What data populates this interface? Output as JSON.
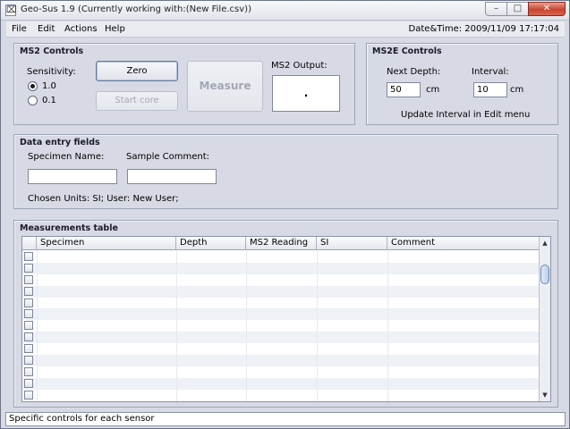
{
  "window": {
    "title": "Geo-Sus 1.9 (Currently working with:(New File.csv))",
    "minimize": "–",
    "maximize": "□",
    "close": "✕"
  },
  "menu": {
    "items": [
      "File",
      "Edit",
      "Actions",
      "Help"
    ],
    "datetime": "Date&Time: 2009/11/09 17:17:04"
  },
  "ms2": {
    "title": "MS2 Controls",
    "sensitivity_label": "Sensitivity:",
    "option_1": "1.0",
    "option_2": "0.1",
    "selected": "1.0",
    "zero_button": "Zero",
    "start_core_button": "Start core",
    "measure_button": "Measure",
    "output_label": "MS2 Output:",
    "output_value": "."
  },
  "ms2e": {
    "title": "MS2E Controls",
    "next_depth_label": "Next Depth:",
    "next_depth_value": "50",
    "next_depth_unit": "cm",
    "interval_label": "Interval:",
    "interval_value": "10",
    "interval_unit": "cm",
    "update_note": "Update Interval in Edit menu"
  },
  "data_entry": {
    "title": "Data entry fields",
    "specimen_label": "Specimen Name:",
    "specimen_value": "",
    "comment_label": "Sample Comment:",
    "comment_value": "",
    "units_info": "Chosen Units: SI;  User: New User;"
  },
  "table": {
    "title": "Measurements table",
    "columns": [
      "Specimen",
      "Depth",
      "MS2 Reading",
      "SI",
      "Comment"
    ],
    "row_count": 13
  },
  "statusbar": {
    "text": "Specific controls for each sensor"
  },
  "icons": {
    "app": "app-icon",
    "scroll_up": "arrow-up-icon",
    "scroll_down": "arrow-down-icon"
  }
}
